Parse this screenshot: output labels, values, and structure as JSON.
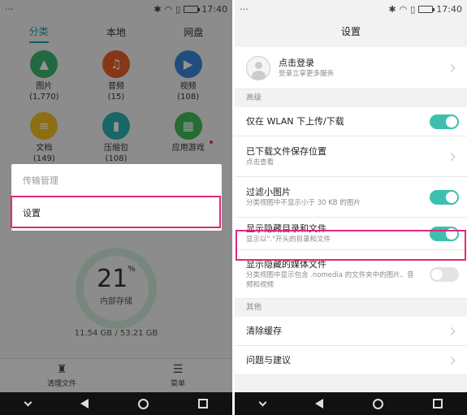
{
  "status": {
    "time": "17:40"
  },
  "left": {
    "tabs": [
      {
        "label": "分类",
        "active": true
      },
      {
        "label": "本地",
        "active": false
      },
      {
        "label": "网盘",
        "active": false
      }
    ],
    "categories": [
      {
        "label": "图片",
        "count": "(1,770)",
        "icon": "image-icon",
        "color": "#3cb371",
        "glyph": "▲"
      },
      {
        "label": "音频",
        "count": "(15)",
        "icon": "music-icon",
        "color": "#e5602a",
        "glyph": "♫"
      },
      {
        "label": "视频",
        "count": "(108)",
        "icon": "video-icon",
        "color": "#3a86d8",
        "glyph": "▶"
      },
      {
        "label": "文档",
        "count": "(149)",
        "icon": "document-icon",
        "color": "#f0c020",
        "glyph": "≡"
      },
      {
        "label": "压缩包",
        "count": "(108)",
        "icon": "archive-icon",
        "color": "#2ab0b0",
        "glyph": "▮"
      },
      {
        "label": "应用游戏",
        "count": "",
        "icon": "apps-icon",
        "color": "#41b85a",
        "glyph": "▦"
      }
    ],
    "storage": {
      "percent": "21",
      "percent_sign": "%",
      "label": "内部存储",
      "size": "11.54 GB / 53.21 GB"
    },
    "bottom": [
      {
        "label": "清理文件",
        "icon": "broom-icon",
        "glyph": "♜"
      },
      {
        "label": "菜单",
        "icon": "menu-icon",
        "glyph": "☰"
      }
    ],
    "menu": [
      {
        "label": "传输管理"
      },
      {
        "label": "设置"
      }
    ]
  },
  "right": {
    "title": "设置",
    "login": {
      "title": "点击登录",
      "subtitle": "登录立享更多服务"
    },
    "section_advanced": "高级",
    "rows": [
      {
        "title": "仅在 WLAN 下上传/下载",
        "subtitle": "",
        "control": "toggle",
        "on": true
      },
      {
        "title": "已下载文件保存位置",
        "subtitle": "点击查看",
        "control": "chevron"
      },
      {
        "title": "过滤小图片",
        "subtitle": "分类视图中不显示小于 30 KB 的图片",
        "control": "toggle",
        "on": true
      },
      {
        "title": "显示隐藏目录和文件",
        "subtitle": "显示以\".\"开头的目录和文件",
        "control": "toggle",
        "on": true
      },
      {
        "title": "显示隐藏的媒体文件",
        "subtitle": "分类视图中显示包含 .nomedia 的文件夹中的图片、音频和视频",
        "control": "toggle",
        "on": false
      }
    ],
    "section_other": "其他",
    "other_rows": [
      {
        "title": "清除缓存"
      },
      {
        "title": "问题与建议"
      }
    ]
  },
  "colors": {
    "accent": "#3dbfb0",
    "highlight": "#e0287a",
    "tab_active": "#1aa0a0"
  }
}
